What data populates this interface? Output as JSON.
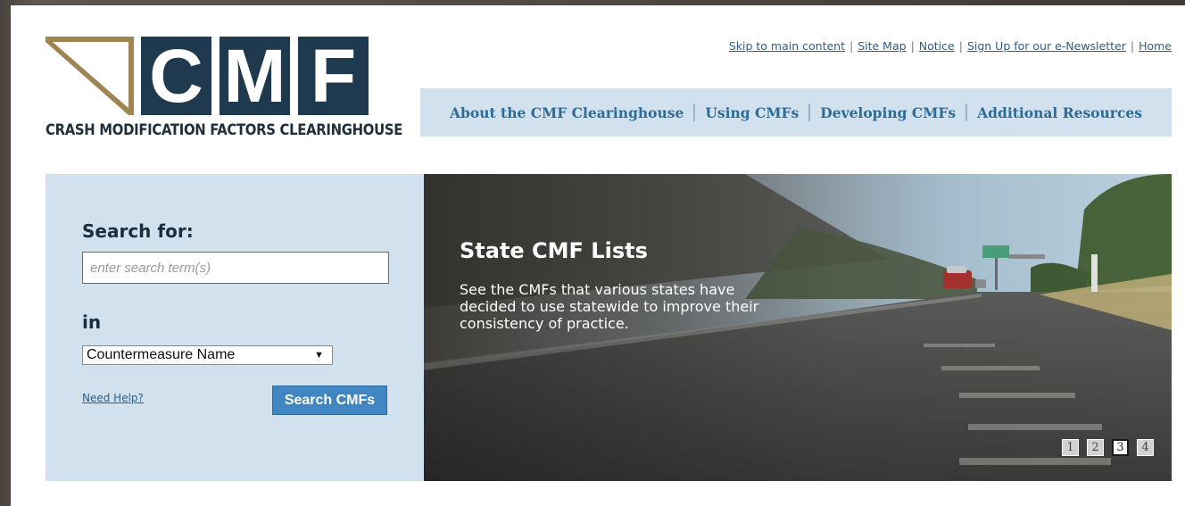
{
  "logo": {
    "letters": [
      "C",
      "M",
      "F"
    ],
    "tagline": "CRASH MODIFICATION FACTORS CLEARINGHOUSE",
    "colors": {
      "navy": "#1f3a4e",
      "gold": "#a08452"
    }
  },
  "top_links": [
    "Skip to main content",
    "Site Map",
    "Notice",
    "Sign Up for our e-Newsletter",
    "Home"
  ],
  "top_links_separator": "|",
  "main_nav": [
    "About the CMF Clearinghouse",
    "Using CMFs",
    "Developing CMFs",
    "Additional Resources"
  ],
  "search": {
    "heading": "Search for:",
    "placeholder": "enter search term(s)",
    "value": "",
    "in_label": "in",
    "field_selected": "Countermeasure Name",
    "help_link": "Need Help?",
    "button_label": "Search CMFs"
  },
  "hero": {
    "title": "State CMF Lists",
    "body": "See the CMFs that various states have decided to use statewide to improve their consistency of practice.",
    "pages": [
      "1",
      "2",
      "3",
      "4"
    ],
    "active_page": 3
  },
  "colors": {
    "nav_bg": "#d1e1ed",
    "nav_text": "#2d6b98",
    "link": "#2a5f8d",
    "button": "#3f86c2"
  }
}
